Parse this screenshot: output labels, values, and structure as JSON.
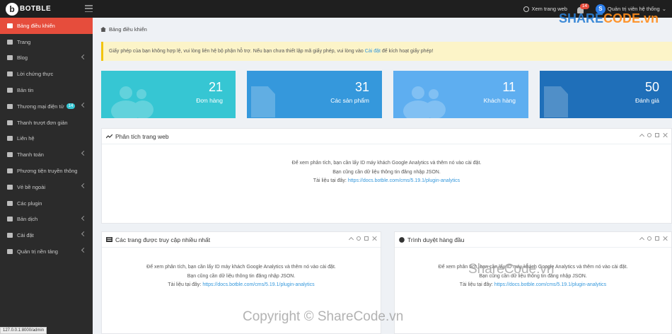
{
  "brand": {
    "name": "BOTBLE"
  },
  "topbar": {
    "view_site": "Xem trang web",
    "notification_count": "14",
    "user_initial": "S",
    "user_name": "Quản trị viên hệ thống"
  },
  "sidebar": {
    "items": [
      {
        "label": "Bảng điều khiển",
        "icon": "dashboard-icon",
        "active": true
      },
      {
        "label": "Trang",
        "icon": "book-icon"
      },
      {
        "label": "Blog",
        "icon": "book-icon",
        "chevron": true
      },
      {
        "label": "Lời chứng thực",
        "icon": "comment-icon"
      },
      {
        "label": "Bản tin",
        "icon": "newspaper-icon"
      },
      {
        "label": "Thương mại điện tử",
        "icon": "cart-icon",
        "badge": "14",
        "chevron": true
      },
      {
        "label": "Thanh trượt đơn giản",
        "icon": "image-icon"
      },
      {
        "label": "Liên hệ",
        "icon": "envelope-icon"
      },
      {
        "label": "Thanh toán",
        "icon": "credit-card-icon",
        "chevron": true
      },
      {
        "label": "Phương tiện truyền thông",
        "icon": "media-icon"
      },
      {
        "label": "Vẻ bề ngoài",
        "icon": "brush-icon",
        "chevron": true
      },
      {
        "label": "Các plugin",
        "icon": "plug-icon"
      },
      {
        "label": "Bản dịch",
        "icon": "language-icon",
        "chevron": true
      },
      {
        "label": "Cài đặt",
        "icon": "cogs-icon",
        "chevron": true
      },
      {
        "label": "Quản trị nền tảng",
        "icon": "user-shield-icon",
        "chevron": true
      }
    ]
  },
  "status_url": "127.0.0.1:8000/admin",
  "breadcrumb": "Bảng điều khiển",
  "alert": {
    "text_before": "Giấy phép của bạn không hợp lệ, vui lòng liên hệ bộ phận hỗ trợ. Nếu bạn chưa thiết lập mã giấy phép, vui lòng vào ",
    "link": "Cài đặt",
    "text_after": " để kích hoạt giấy phép!"
  },
  "stats": [
    {
      "value": "21",
      "label": "Đơn hàng",
      "color": "#36c6d3",
      "icon": "users-icon"
    },
    {
      "value": "31",
      "label": "Các sản phẩm",
      "color": "#3598dc",
      "icon": "file-icon"
    },
    {
      "value": "11",
      "label": "Khách hàng",
      "color": "#5eaef0",
      "icon": "users-icon"
    },
    {
      "value": "50",
      "label": "Đánh giá",
      "color": "#1f6fb9",
      "icon": "file-icon"
    }
  ],
  "panels": {
    "analytics": {
      "title": "Phân tích trang web",
      "icon": "chart-line-icon"
    },
    "top_pages": {
      "title": "Các trang được truy cập nhiều nhất",
      "icon": "list-icon"
    },
    "browsers": {
      "title": "Trình duyệt hàng đầu",
      "icon": "globe-icon"
    }
  },
  "panel_message": {
    "line1": "Để xem phân tích, bạn cần lấy ID máy khách Google Analytics và thêm nó vào cài đặt.",
    "line2": "Bạn cũng cần dữ liệu thông tin đăng nhập JSON.",
    "line3_prefix": "Tài liệu tại đây: ",
    "link": "https://docs.botble.com/cms/5.19.1/plugin-analytics"
  },
  "watermarks": {
    "logo_part1": "SHARE",
    "logo_part2": "CODE.vn",
    "mid": "ShareCode.vn",
    "bottom": "Copyright © ShareCode.vn"
  }
}
